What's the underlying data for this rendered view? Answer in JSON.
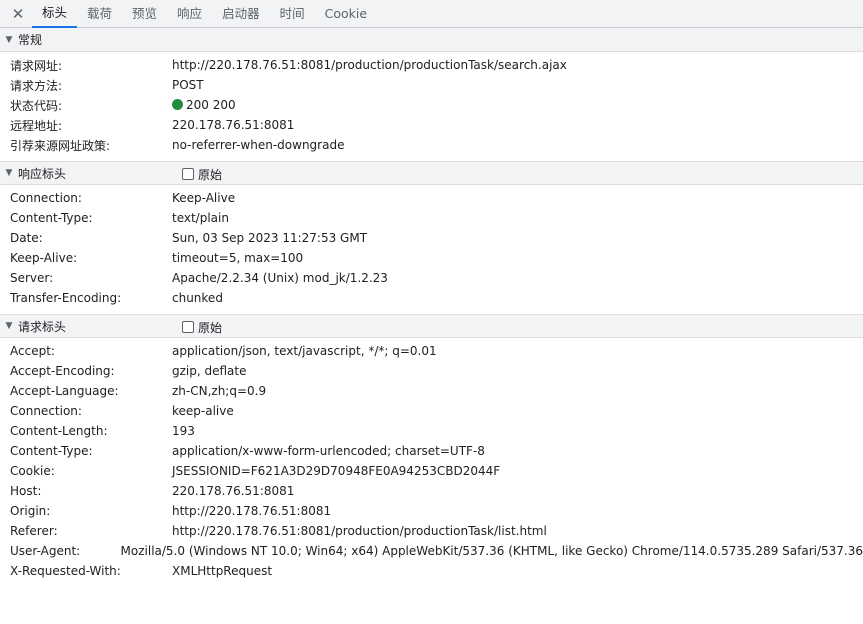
{
  "tabs": [
    {
      "label": "标头",
      "active": true
    },
    {
      "label": "载荷"
    },
    {
      "label": "预览"
    },
    {
      "label": "响应"
    },
    {
      "label": "启动器"
    },
    {
      "label": "时间"
    },
    {
      "label": "Cookie"
    }
  ],
  "general": {
    "title": "常规",
    "rows": [
      {
        "k": "请求网址:",
        "v": "http://220.178.76.51:8081/production/productionTask/search.ajax"
      },
      {
        "k": "请求方法:",
        "v": "POST"
      },
      {
        "k": "状态代码:",
        "v": "200 200",
        "status_color": "#1e8e3e"
      },
      {
        "k": "远程地址:",
        "v": "220.178.76.51:8081"
      },
      {
        "k": "引荐来源网址政策:",
        "v": "no-referrer-when-downgrade"
      }
    ]
  },
  "response": {
    "title": "响应标头",
    "raw_label": "原始",
    "rows": [
      {
        "k": "Connection:",
        "v": "Keep-Alive"
      },
      {
        "k": "Content-Type:",
        "v": "text/plain"
      },
      {
        "k": "Date:",
        "v": "Sun, 03 Sep 2023 11:27:53 GMT"
      },
      {
        "k": "Keep-Alive:",
        "v": "timeout=5, max=100"
      },
      {
        "k": "Server:",
        "v": "Apache/2.2.34 (Unix) mod_jk/1.2.23"
      },
      {
        "k": "Transfer-Encoding:",
        "v": "chunked"
      }
    ]
  },
  "request": {
    "title": "请求标头",
    "raw_label": "原始",
    "rows": [
      {
        "k": "Accept:",
        "v": "application/json, text/javascript, */*; q=0.01"
      },
      {
        "k": "Accept-Encoding:",
        "v": "gzip, deflate"
      },
      {
        "k": "Accept-Language:",
        "v": "zh-CN,zh;q=0.9"
      },
      {
        "k": "Connection:",
        "v": "keep-alive"
      },
      {
        "k": "Content-Length:",
        "v": "193"
      },
      {
        "k": "Content-Type:",
        "v": "application/x-www-form-urlencoded; charset=UTF-8"
      },
      {
        "k": "Cookie:",
        "v": "JSESSIONID=F621A3D29D70948FE0A94253CBD2044F"
      },
      {
        "k": "Host:",
        "v": "220.178.76.51:8081"
      },
      {
        "k": "Origin:",
        "v": "http://220.178.76.51:8081"
      },
      {
        "k": "Referer:",
        "v": "http://220.178.76.51:8081/production/productionTask/list.html"
      },
      {
        "k": "User-Agent:",
        "v": "Mozilla/5.0 (Windows NT 10.0; Win64; x64) AppleWebKit/537.36 (KHTML, like Gecko) Chrome/114.0.5735.289 Safari/537.36"
      },
      {
        "k": "X-Requested-With:",
        "v": "XMLHttpRequest"
      }
    ]
  }
}
